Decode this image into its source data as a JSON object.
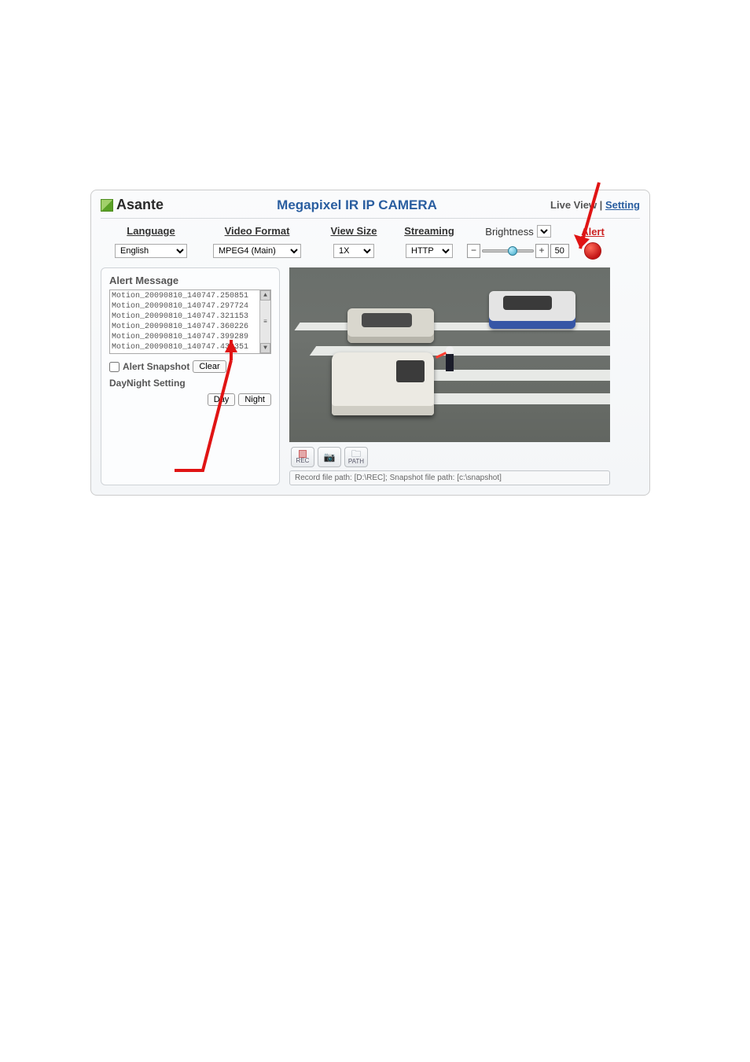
{
  "brand": "Asante",
  "page_title": "Megapixel IR IP CAMERA",
  "topnav": {
    "live_view": "Live View",
    "sep": " | ",
    "setting": "Setting"
  },
  "controls": {
    "language": {
      "label": "Language",
      "value": "English"
    },
    "video_format": {
      "label": "Video Format",
      "value": "MPEG4 (Main)"
    },
    "view_size": {
      "label": "View Size",
      "value": "1X"
    },
    "streaming": {
      "label": "Streaming",
      "value": "HTTP"
    },
    "brightness": {
      "label": "Brightness",
      "value": "50",
      "minus": "−",
      "plus": "+"
    },
    "alert": {
      "label": "Alert"
    }
  },
  "alerts": {
    "title": "Alert Message",
    "rows": [
      "Motion_20090810_140747.250851",
      "Motion_20090810_140747.297724",
      "Motion_20090810_140747.321153",
      "Motion_20090810_140747.360226",
      "Motion_20090810_140747.399289",
      "Motion_20090810_140747.438351"
    ],
    "snapshot_label": "Alert Snapshot",
    "clear": "Clear",
    "daynight_label": "DayNight Setting",
    "day": "Day",
    "night": "Night"
  },
  "toolbar": {
    "rec": "REC",
    "path": "PATH"
  },
  "status": "Record file path: [D:\\REC]; Snapshot file path: [c:\\snapshot]"
}
